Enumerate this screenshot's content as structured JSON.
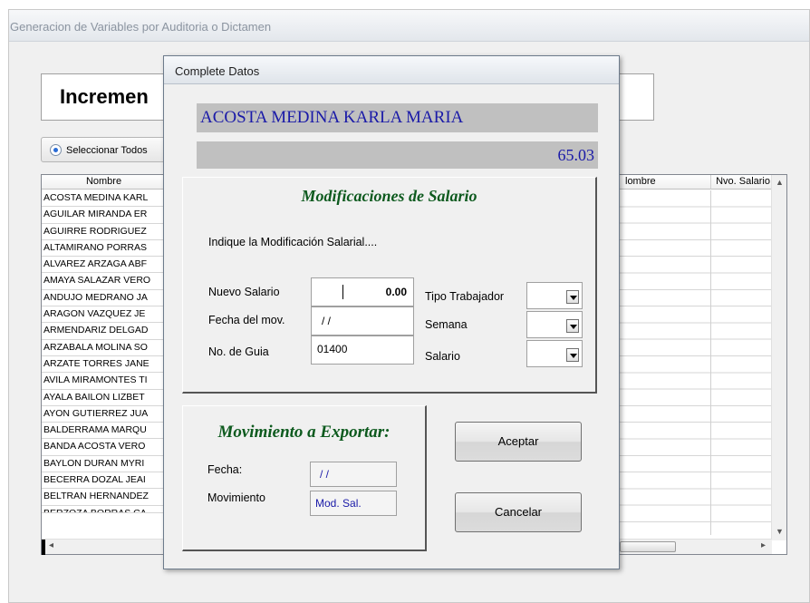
{
  "window": {
    "title": "Generacion de Variables por Auditoria o Dictamen"
  },
  "heading": {
    "text": "Incremen"
  },
  "select_all": {
    "label": "Seleccionar Todos"
  },
  "grid": {
    "columns": [
      "Nombre",
      "lombre",
      "Nvo. Salario"
    ],
    "rows": [
      "ACOSTA MEDINA KARL",
      "AGUILAR MIRANDA ER",
      "AGUIRRE RODRIGUEZ",
      "ALTAMIRANO PORRAS",
      "ALVAREZ ARZAGA ABF",
      "AMAYA SALAZAR VERO",
      "ANDUJO MEDRANO JA",
      "ARAGON VAZQUEZ JE",
      "ARMENDARIZ DELGAD",
      "ARZABALA MOLINA SO",
      "ARZATE TORRES JANE",
      "AVILA MIRAMONTES TI",
      "AYALA BAILON LIZBET",
      "AYON GUTIERREZ JUA",
      "BALDERRAMA MARQU",
      "BANDA ACOSTA VERO",
      "BAYLON DURAN MYRI",
      "BECERRA DOZAL JEAI",
      "BELTRAN HERNANDEZ",
      "BERZOZA BORRAS CA"
    ]
  },
  "dialog": {
    "title": "Complete Datos",
    "employee_name": "ACOSTA MEDINA KARLA MARIA",
    "amount": "65.03",
    "mod_title": "Modificaciones de Salario",
    "instruction": "Indique la Modificación Salarial....",
    "nuevo_salario_label": "Nuevo Salario",
    "nuevo_salario_value": "0.00",
    "fecha_label": "Fecha del mov.",
    "fecha_value": "/ /",
    "guia_label": "No. de Guia",
    "guia_value": "01400",
    "tipo_label": "Tipo Trabajador",
    "semana_label": "Semana",
    "salario_label": "Salario",
    "mov_title": "Movimiento a Exportar:",
    "mov_fecha_label": "Fecha:",
    "mov_fecha_value": "/ /",
    "mov_label": "Movimiento",
    "mov_value": "Mod. Sal.",
    "accept_label": "Aceptar",
    "cancel_label": "Cancelar"
  },
  "colors": {
    "name_text": "#1a1aa8",
    "section_title": "#0d5a1e",
    "panel_gray": "#c0c0c0"
  }
}
